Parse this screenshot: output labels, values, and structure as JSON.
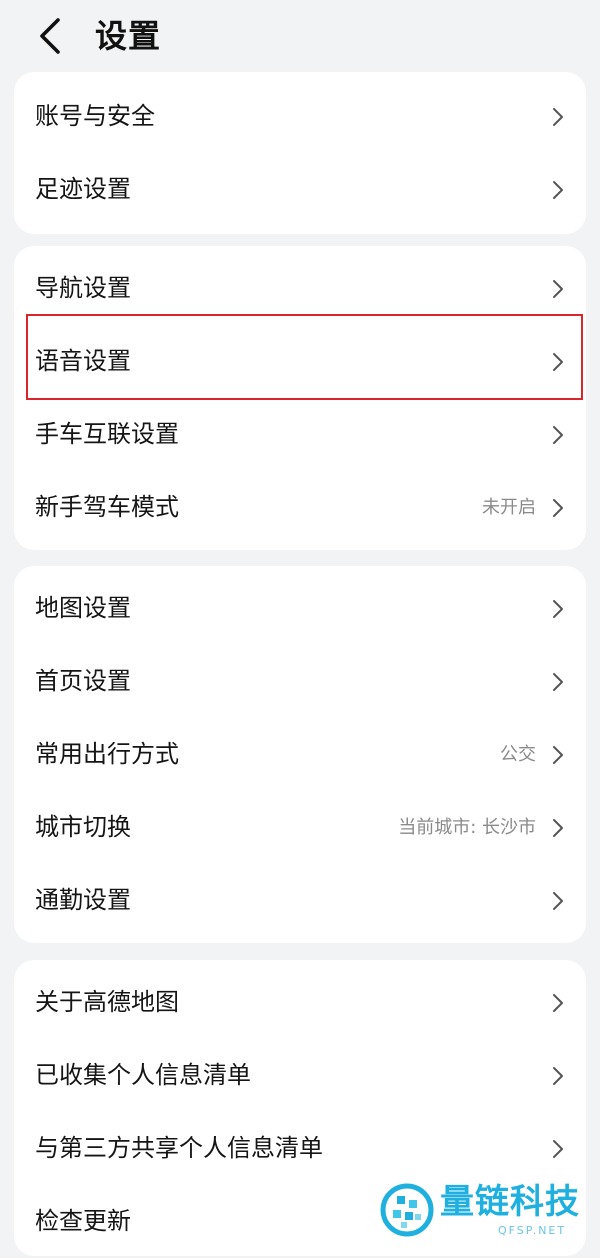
{
  "header": {
    "title": "设置"
  },
  "groups": [
    {
      "items": [
        {
          "label": "账号与安全",
          "value": ""
        },
        {
          "label": "足迹设置",
          "value": ""
        }
      ]
    },
    {
      "items": [
        {
          "label": "导航设置",
          "value": ""
        },
        {
          "label": "语音设置",
          "value": ""
        },
        {
          "label": "手车互联设置",
          "value": ""
        },
        {
          "label": "新手驾车模式",
          "value": "未开启"
        }
      ]
    },
    {
      "items": [
        {
          "label": "地图设置",
          "value": ""
        },
        {
          "label": "首页设置",
          "value": ""
        },
        {
          "label": "常用出行方式",
          "value": "公交"
        },
        {
          "label": "城市切换",
          "value": "当前城市: 长沙市"
        },
        {
          "label": "通勤设置",
          "value": ""
        }
      ]
    },
    {
      "items": [
        {
          "label": "关于高德地图",
          "value": ""
        },
        {
          "label": "已收集个人信息清单",
          "value": ""
        },
        {
          "label": "与第三方共享个人信息清单",
          "value": ""
        },
        {
          "label": "检查更新",
          "value": ""
        }
      ]
    }
  ],
  "watermark": {
    "text": "量链科技",
    "sub": "QFSP.NET"
  },
  "colors": {
    "background": "#f1f3f5",
    "card": "#ffffff",
    "highlight": "#d9252b",
    "watermark": "#20b0e0"
  },
  "icons": {
    "back": "chevron-left-icon",
    "row_arrow": "chevron-right-icon"
  }
}
